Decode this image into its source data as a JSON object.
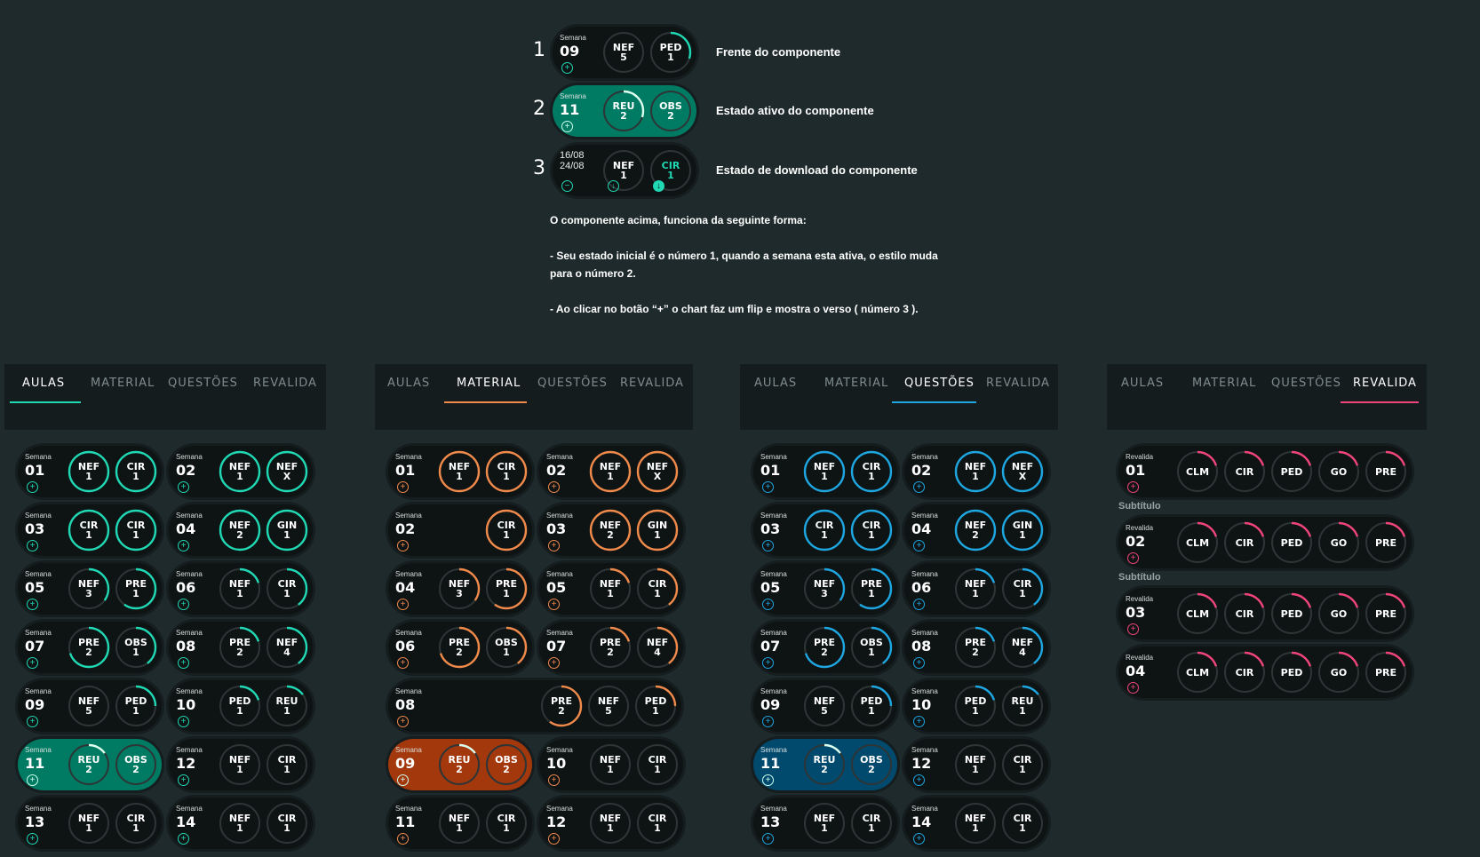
{
  "legend": {
    "rows": [
      {
        "num": "1",
        "text": "Frente do componente"
      },
      {
        "num": "2",
        "text": "Estado ativo do componente"
      },
      {
        "num": "3",
        "text": "Estado de download do componente"
      }
    ],
    "card1": {
      "label": "Semana",
      "week": "09",
      "rings": [
        {
          "code": "NEF",
          "count": "5"
        },
        {
          "code": "PED",
          "count": "1"
        }
      ]
    },
    "card2": {
      "label": "Semana",
      "week": "11",
      "rings": [
        {
          "code": "REU",
          "count": "2"
        },
        {
          "code": "OBS",
          "count": "2"
        }
      ]
    },
    "card3": {
      "dates": [
        "16/08",
        "24/08"
      ],
      "rings": [
        {
          "code": "NEF",
          "count": "1"
        },
        {
          "code": "CIR",
          "count": "1"
        }
      ]
    }
  },
  "description": {
    "intro": "O componente acima, funciona da seguinte forma:",
    "p1": "- Seu estado inicial é o número 1, quando a semana esta ativa, o estilo muda para o número 2.",
    "p2": "- Ao clicar no botão “+”  o chart faz um flip e mostra o verso ( número 3 )."
  },
  "tabs": [
    "AULAS",
    "MATERIAL",
    "QUESTÕES",
    "REVALIDA"
  ],
  "colors": {
    "teal": "#20d8b4",
    "orange": "#f08a4b",
    "blue": "#1ea6e0",
    "pink": "#f0457a",
    "card": "#0e1314",
    "teal_active": "#007b63",
    "orange_active": "#a3380c",
    "blue_active": "#014a6e"
  },
  "panels": [
    {
      "name": "aulas",
      "active_tab": 0,
      "accent": "teal",
      "cards": [
        {
          "week": "01",
          "rings": [
            [
              "NEF",
              "1",
              1
            ],
            [
              "CIR",
              "1",
              1
            ]
          ]
        },
        {
          "week": "02",
          "rings": [
            [
              "NEF",
              "1",
              1
            ],
            [
              "NEF",
              "X",
              1
            ]
          ]
        },
        {
          "week": "03",
          "rings": [
            [
              "CIR",
              "1",
              1
            ],
            [
              "CIR",
              "1",
              1
            ]
          ]
        },
        {
          "week": "04",
          "rings": [
            [
              "NEF",
              "2",
              1
            ],
            [
              "GIN",
              "1",
              1
            ]
          ]
        },
        {
          "week": "05",
          "rings": [
            [
              "NEF",
              "3",
              0.35
            ],
            [
              "PRE",
              "1",
              0.6
            ]
          ]
        },
        {
          "week": "06",
          "rings": [
            [
              "NEF",
              "1",
              0.2
            ],
            [
              "CIR",
              "1",
              0.4
            ]
          ]
        },
        {
          "week": "07",
          "rings": [
            [
              "PRE",
              "2",
              0.7
            ],
            [
              "OBS",
              "1",
              0.4
            ]
          ]
        },
        {
          "week": "08",
          "rings": [
            [
              "PRE",
              "2",
              0.2
            ],
            [
              "NEF",
              "4",
              0.4
            ]
          ]
        },
        {
          "week": "09",
          "rings": [
            [
              "NEF",
              "5",
              0
            ],
            [
              "PED",
              "1",
              0.25
            ]
          ]
        },
        {
          "week": "10",
          "rings": [
            [
              "PED",
              "1",
              0.2
            ],
            [
              "REU",
              "1",
              0.15
            ]
          ]
        },
        {
          "week": "11",
          "active": true,
          "rings": [
            [
              "REU",
              "2",
              0.15
            ],
            [
              "OBS",
              "2",
              0
            ]
          ]
        },
        {
          "week": "12",
          "rings": [
            [
              "NEF",
              "1",
              0
            ],
            [
              "CIR",
              "1",
              0
            ]
          ]
        },
        {
          "week": "13",
          "rings": [
            [
              "NEF",
              "1",
              0
            ],
            [
              "CIR",
              "1",
              0
            ]
          ]
        },
        {
          "week": "14",
          "rings": [
            [
              "NEF",
              "1",
              0
            ],
            [
              "CIR",
              "1",
              0
            ]
          ]
        }
      ]
    },
    {
      "name": "material",
      "active_tab": 1,
      "accent": "orange",
      "cards": [
        {
          "week": "01",
          "rings": [
            [
              "NEF",
              "1",
              1
            ],
            [
              "CIR",
              "1",
              1
            ]
          ]
        },
        {
          "week": "02",
          "rings": [
            [
              "NEF",
              "1",
              1
            ],
            [
              "NEF",
              "X",
              1
            ]
          ]
        },
        {
          "week": "02",
          "rings": [
            [
              "CIR",
              "1",
              1
            ]
          ]
        },
        {
          "week": "03",
          "rings": [
            [
              "NEF",
              "2",
              1
            ],
            [
              "GIN",
              "1",
              1
            ]
          ]
        },
        {
          "week": "04",
          "rings": [
            [
              "NEF",
              "3",
              0.35
            ],
            [
              "PRE",
              "1",
              0.6
            ]
          ]
        },
        {
          "week": "05",
          "rings": [
            [
              "NEF",
              "1",
              0.2
            ],
            [
              "CIR",
              "1",
              0.4
            ]
          ]
        },
        {
          "week": "06",
          "rings": [
            [
              "PRE",
              "2",
              0.7
            ],
            [
              "OBS",
              "1",
              0.4
            ]
          ]
        },
        {
          "week": "07",
          "rings": [
            [
              "PRE",
              "2",
              0.2
            ],
            [
              "NEF",
              "4",
              0.4
            ]
          ]
        },
        {
          "week": "08",
          "wide": true,
          "rings": [
            [
              "PRE",
              "2",
              0.6
            ],
            [
              "NEF",
              "5",
              0
            ],
            [
              "PED",
              "1",
              0.25
            ]
          ]
        },
        {
          "week": "09",
          "active": true,
          "rings": [
            [
              "REU",
              "2",
              0.15
            ],
            [
              "OBS",
              "2",
              0
            ]
          ]
        },
        {
          "week": "10",
          "rings": [
            [
              "NEF",
              "1",
              0
            ],
            [
              "CIR",
              "1",
              0
            ]
          ]
        },
        {
          "week": "11",
          "rings": [
            [
              "NEF",
              "1",
              0
            ],
            [
              "CIR",
              "1",
              0
            ]
          ]
        },
        {
          "week": "12",
          "rings": [
            [
              "NEF",
              "1",
              0
            ],
            [
              "CIR",
              "1",
              0
            ]
          ]
        }
      ]
    },
    {
      "name": "questoes",
      "active_tab": 2,
      "accent": "blue",
      "cards": [
        {
          "week": "01",
          "rings": [
            [
              "NEF",
              "1",
              1
            ],
            [
              "CIR",
              "1",
              1
            ]
          ]
        },
        {
          "week": "02",
          "rings": [
            [
              "NEF",
              "1",
              1
            ],
            [
              "NEF",
              "X",
              1
            ]
          ]
        },
        {
          "week": "03",
          "rings": [
            [
              "CIR",
              "1",
              1
            ],
            [
              "CIR",
              "1",
              1
            ]
          ]
        },
        {
          "week": "04",
          "rings": [
            [
              "NEF",
              "2",
              1
            ],
            [
              "GIN",
              "1",
              1
            ]
          ]
        },
        {
          "week": "05",
          "rings": [
            [
              "NEF",
              "3",
              0.35
            ],
            [
              "PRE",
              "1",
              0.6
            ]
          ]
        },
        {
          "week": "06",
          "rings": [
            [
              "NEF",
              "1",
              0.2
            ],
            [
              "CIR",
              "1",
              0.4
            ]
          ]
        },
        {
          "week": "07",
          "rings": [
            [
              "PRE",
              "2",
              0.7
            ],
            [
              "OBS",
              "1",
              0.4
            ]
          ]
        },
        {
          "week": "08",
          "rings": [
            [
              "PRE",
              "2",
              0.2
            ],
            [
              "NEF",
              "4",
              0.4
            ]
          ]
        },
        {
          "week": "09",
          "rings": [
            [
              "NEF",
              "5",
              0
            ],
            [
              "PED",
              "1",
              0.25
            ]
          ]
        },
        {
          "week": "10",
          "rings": [
            [
              "PED",
              "1",
              0.2
            ],
            [
              "REU",
              "1",
              0.15
            ]
          ]
        },
        {
          "week": "11",
          "active": true,
          "rings": [
            [
              "REU",
              "2",
              0.15
            ],
            [
              "OBS",
              "2",
              0
            ]
          ]
        },
        {
          "week": "12",
          "rings": [
            [
              "NEF",
              "1",
              0
            ],
            [
              "CIR",
              "1",
              0
            ]
          ]
        },
        {
          "week": "13",
          "rings": [
            [
              "NEF",
              "1",
              0
            ],
            [
              "CIR",
              "1",
              0
            ]
          ]
        },
        {
          "week": "14",
          "rings": [
            [
              "NEF",
              "1",
              0
            ],
            [
              "CIR",
              "1",
              0
            ]
          ]
        }
      ]
    },
    {
      "name": "revalida",
      "active_tab": 3,
      "accent": "pink",
      "cards": [
        {
          "label": "Revalida",
          "week": "01",
          "rings": [
            [
              "CLM",
              "",
              0.2
            ],
            [
              "CIR",
              "",
              0.2
            ],
            [
              "PED",
              "",
              0.2
            ],
            [
              "GO",
              "",
              0.2
            ],
            [
              "PRE",
              "",
              0.2
            ]
          ]
        },
        {
          "subtitle": "Subtítulo",
          "label": "Revalida",
          "week": "02",
          "rings": [
            [
              "CLM",
              "",
              0.2
            ],
            [
              "CIR",
              "",
              0.2
            ],
            [
              "PED",
              "",
              0.2
            ],
            [
              "GO",
              "",
              0.2
            ],
            [
              "PRE",
              "",
              0.2
            ]
          ]
        },
        {
          "subtitle": "Subtítulo",
          "label": "Revalida",
          "week": "03",
          "rings": [
            [
              "CLM",
              "",
              0.2
            ],
            [
              "CIR",
              "",
              0.2
            ],
            [
              "PED",
              "",
              0.2
            ],
            [
              "GO",
              "",
              0.2
            ],
            [
              "PRE",
              "",
              0.2
            ]
          ]
        },
        {
          "label": "Revalida",
          "week": "04",
          "rings": [
            [
              "CLM",
              "",
              0.2
            ],
            [
              "CIR",
              "",
              0.2
            ],
            [
              "PED",
              "",
              0.2
            ],
            [
              "GO",
              "",
              0.2
            ],
            [
              "PRE",
              "",
              0.2
            ]
          ]
        }
      ]
    }
  ]
}
